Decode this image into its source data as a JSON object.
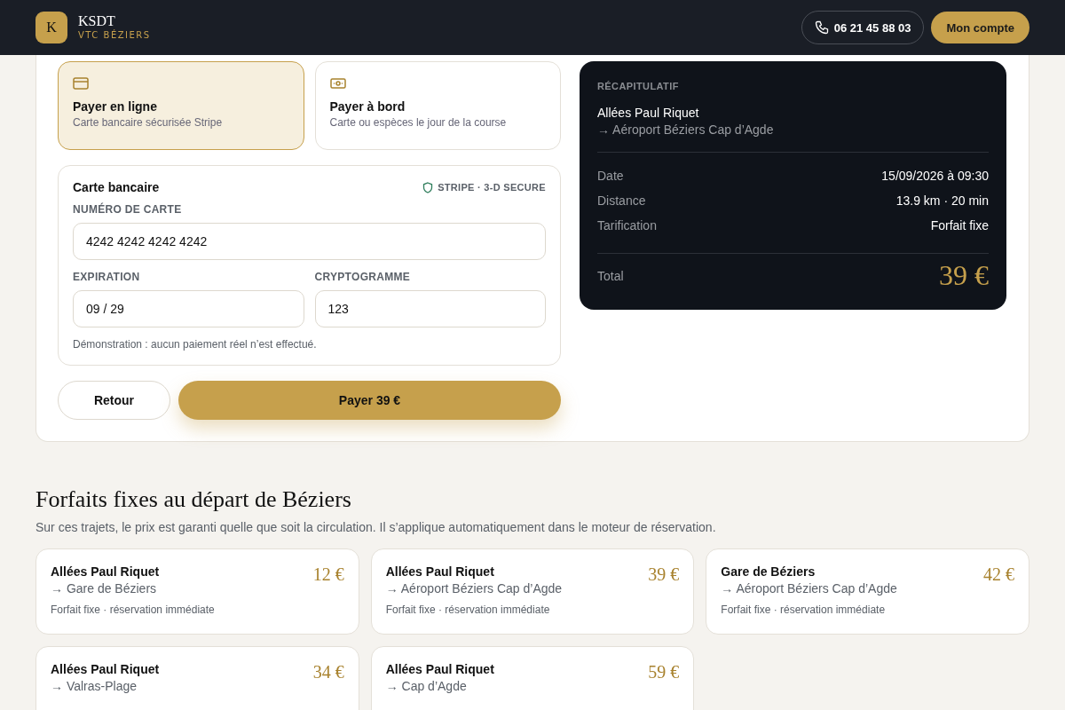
{
  "header": {
    "logo_letter": "K",
    "brand": "KSDT",
    "tagline": "VTC BÉZIERS",
    "phone": "06 21 45 88 03",
    "account_button": "Mon compte"
  },
  "payment_options": [
    {
      "kind": "card",
      "title": "Payer en ligne",
      "subtitle": "Carte bancaire sécurisée Stripe",
      "selected": true
    },
    {
      "kind": "cash",
      "title": "Payer à bord",
      "subtitle": "Carte ou espèces le jour de la course",
      "selected": false
    }
  ],
  "card_form": {
    "title": "Carte bancaire",
    "badge": "STRIPE · 3-D SECURE",
    "fields": [
      {
        "label": "NUMÉRO DE CARTE",
        "value": "4242 4242 4242 4242",
        "kind": "wide"
      },
      {
        "label": "EXPIRATION",
        "value": "09 / 29",
        "kind": "narrow"
      },
      {
        "label": "CRYPTOGRAMME",
        "value": "123",
        "kind": "narrow"
      }
    ],
    "note": "Démonstration : aucun paiement réel n’est effectué."
  },
  "actions": {
    "back": "Retour",
    "pay": "Payer 39 €"
  },
  "summary": {
    "heading": "RÉCAPITULATIF",
    "from": "Allées Paul Riquet",
    "to": "→ Aéroport Béziers Cap d’Agde",
    "rows": [
      {
        "label": "Date",
        "value": "15/09/2026 à 09:30"
      },
      {
        "label": "Distance",
        "value": "13.9 km · 20 min"
      },
      {
        "label": "Tarification",
        "value": "Forfait fixe"
      }
    ],
    "total_label": "Total",
    "total": "39 €"
  },
  "fixed_prices": {
    "title": "Forfaits fixes au départ de Béziers",
    "subtitle": "Sur ces trajets, le prix est garanti quelle que soit la circulation. Il s’applique automatiquement dans le moteur de réservation.",
    "cards": [
      {
        "from": "Allées Paul Riquet",
        "to": "→ Gare de Béziers",
        "price": "12 €",
        "meta": "Forfait fixe · réservation immédiate"
      },
      {
        "from": "Allées Paul Riquet",
        "to": "→ Aéroport Béziers Cap d’Agde",
        "price": "39 €",
        "meta": "Forfait fixe · réservation immédiate"
      },
      {
        "from": "Gare de Béziers",
        "to": "→ Aéroport Béziers Cap d’Agde",
        "price": "42 €",
        "meta": "Forfait fixe · réservation immédiate"
      },
      {
        "from": "Allées Paul Riquet",
        "to": "→ Valras-Plage",
        "price": "34 €"
      },
      {
        "from": "Allées Paul Riquet",
        "to": "→ Cap d’Agde",
        "price": "59 €"
      }
    ]
  }
}
